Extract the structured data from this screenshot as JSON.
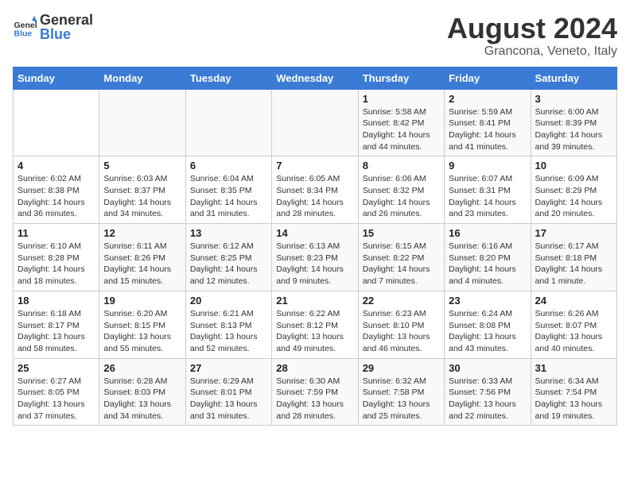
{
  "header": {
    "logo_general": "General",
    "logo_blue": "Blue",
    "month_year": "August 2024",
    "location": "Grancona, Veneto, Italy"
  },
  "weekdays": [
    "Sunday",
    "Monday",
    "Tuesday",
    "Wednesday",
    "Thursday",
    "Friday",
    "Saturday"
  ],
  "weeks": [
    [
      {
        "day": "",
        "info": ""
      },
      {
        "day": "",
        "info": ""
      },
      {
        "day": "",
        "info": ""
      },
      {
        "day": "",
        "info": ""
      },
      {
        "day": "1",
        "info": "Sunrise: 5:58 AM\nSunset: 8:42 PM\nDaylight: 14 hours\nand 44 minutes."
      },
      {
        "day": "2",
        "info": "Sunrise: 5:59 AM\nSunset: 8:41 PM\nDaylight: 14 hours\nand 41 minutes."
      },
      {
        "day": "3",
        "info": "Sunrise: 6:00 AM\nSunset: 8:39 PM\nDaylight: 14 hours\nand 39 minutes."
      }
    ],
    [
      {
        "day": "4",
        "info": "Sunrise: 6:02 AM\nSunset: 8:38 PM\nDaylight: 14 hours\nand 36 minutes."
      },
      {
        "day": "5",
        "info": "Sunrise: 6:03 AM\nSunset: 8:37 PM\nDaylight: 14 hours\nand 34 minutes."
      },
      {
        "day": "6",
        "info": "Sunrise: 6:04 AM\nSunset: 8:35 PM\nDaylight: 14 hours\nand 31 minutes."
      },
      {
        "day": "7",
        "info": "Sunrise: 6:05 AM\nSunset: 8:34 PM\nDaylight: 14 hours\nand 28 minutes."
      },
      {
        "day": "8",
        "info": "Sunrise: 6:06 AM\nSunset: 8:32 PM\nDaylight: 14 hours\nand 26 minutes."
      },
      {
        "day": "9",
        "info": "Sunrise: 6:07 AM\nSunset: 8:31 PM\nDaylight: 14 hours\nand 23 minutes."
      },
      {
        "day": "10",
        "info": "Sunrise: 6:09 AM\nSunset: 8:29 PM\nDaylight: 14 hours\nand 20 minutes."
      }
    ],
    [
      {
        "day": "11",
        "info": "Sunrise: 6:10 AM\nSunset: 8:28 PM\nDaylight: 14 hours\nand 18 minutes."
      },
      {
        "day": "12",
        "info": "Sunrise: 6:11 AM\nSunset: 8:26 PM\nDaylight: 14 hours\nand 15 minutes."
      },
      {
        "day": "13",
        "info": "Sunrise: 6:12 AM\nSunset: 8:25 PM\nDaylight: 14 hours\nand 12 minutes."
      },
      {
        "day": "14",
        "info": "Sunrise: 6:13 AM\nSunset: 8:23 PM\nDaylight: 14 hours\nand 9 minutes."
      },
      {
        "day": "15",
        "info": "Sunrise: 6:15 AM\nSunset: 8:22 PM\nDaylight: 14 hours\nand 7 minutes."
      },
      {
        "day": "16",
        "info": "Sunrise: 6:16 AM\nSunset: 8:20 PM\nDaylight: 14 hours\nand 4 minutes."
      },
      {
        "day": "17",
        "info": "Sunrise: 6:17 AM\nSunset: 8:18 PM\nDaylight: 14 hours\nand 1 minute."
      }
    ],
    [
      {
        "day": "18",
        "info": "Sunrise: 6:18 AM\nSunset: 8:17 PM\nDaylight: 13 hours\nand 58 minutes."
      },
      {
        "day": "19",
        "info": "Sunrise: 6:20 AM\nSunset: 8:15 PM\nDaylight: 13 hours\nand 55 minutes."
      },
      {
        "day": "20",
        "info": "Sunrise: 6:21 AM\nSunset: 8:13 PM\nDaylight: 13 hours\nand 52 minutes."
      },
      {
        "day": "21",
        "info": "Sunrise: 6:22 AM\nSunset: 8:12 PM\nDaylight: 13 hours\nand 49 minutes."
      },
      {
        "day": "22",
        "info": "Sunrise: 6:23 AM\nSunset: 8:10 PM\nDaylight: 13 hours\nand 46 minutes."
      },
      {
        "day": "23",
        "info": "Sunrise: 6:24 AM\nSunset: 8:08 PM\nDaylight: 13 hours\nand 43 minutes."
      },
      {
        "day": "24",
        "info": "Sunrise: 6:26 AM\nSunset: 8:07 PM\nDaylight: 13 hours\nand 40 minutes."
      }
    ],
    [
      {
        "day": "25",
        "info": "Sunrise: 6:27 AM\nSunset: 8:05 PM\nDaylight: 13 hours\nand 37 minutes."
      },
      {
        "day": "26",
        "info": "Sunrise: 6:28 AM\nSunset: 8:03 PM\nDaylight: 13 hours\nand 34 minutes."
      },
      {
        "day": "27",
        "info": "Sunrise: 6:29 AM\nSunset: 8:01 PM\nDaylight: 13 hours\nand 31 minutes."
      },
      {
        "day": "28",
        "info": "Sunrise: 6:30 AM\nSunset: 7:59 PM\nDaylight: 13 hours\nand 28 minutes."
      },
      {
        "day": "29",
        "info": "Sunrise: 6:32 AM\nSunset: 7:58 PM\nDaylight: 13 hours\nand 25 minutes."
      },
      {
        "day": "30",
        "info": "Sunrise: 6:33 AM\nSunset: 7:56 PM\nDaylight: 13 hours\nand 22 minutes."
      },
      {
        "day": "31",
        "info": "Sunrise: 6:34 AM\nSunset: 7:54 PM\nDaylight: 13 hours\nand 19 minutes."
      }
    ]
  ]
}
